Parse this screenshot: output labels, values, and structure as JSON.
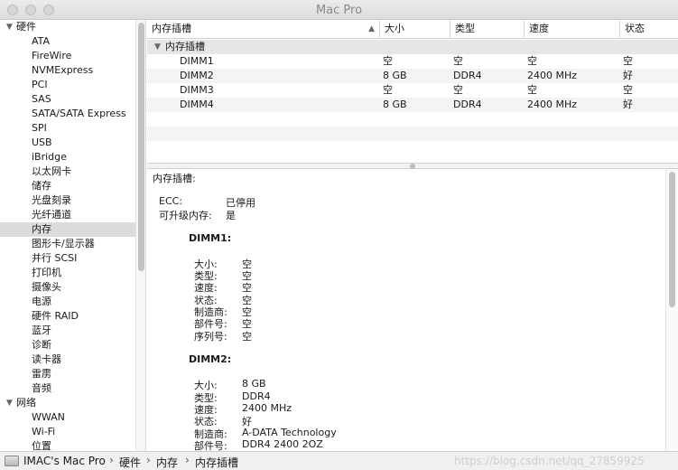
{
  "window": {
    "title": "Mac Pro"
  },
  "sidebar": {
    "groups": [
      {
        "label": "硬件",
        "children": [
          "ATA",
          "FireWire",
          "NVMExpress",
          "PCI",
          "SAS",
          "SATA/SATA Express",
          "SPI",
          "USB",
          "iBridge",
          "以太网卡",
          "储存",
          "光盘刻录",
          "光纤通道",
          "内存",
          "图形卡/显示器",
          "并行 SCSI",
          "打印机",
          "摄像头",
          "电源",
          "硬件 RAID",
          "蓝牙",
          "诊断",
          "读卡器",
          "雷雳",
          "音频"
        ]
      },
      {
        "label": "网络",
        "children": [
          "WWAN",
          "Wi-Fi",
          "位置"
        ]
      }
    ],
    "selected": "内存"
  },
  "table": {
    "columns": [
      "内存插槽",
      "大小",
      "类型",
      "速度",
      "状态"
    ],
    "group_label": "内存插槽",
    "rows": [
      [
        "DIMM1",
        "空",
        "空",
        "空",
        "空"
      ],
      [
        "DIMM2",
        "8 GB",
        "DDR4",
        "2400 MHz",
        "好"
      ],
      [
        "DIMM3",
        "空",
        "空",
        "空",
        "空"
      ],
      [
        "DIMM4",
        "8 GB",
        "DDR4",
        "2400 MHz",
        "好"
      ]
    ]
  },
  "detail": {
    "heading": "内存插槽:",
    "ecc_label": "ECC:",
    "ecc_value": "已停用",
    "upgradable_label": "可升级内存:",
    "upgradable_value": "是",
    "dimm1": {
      "title": "DIMM1:",
      "fields": [
        [
          "大小:",
          "空"
        ],
        [
          "类型:",
          "空"
        ],
        [
          "速度:",
          "空"
        ],
        [
          "状态:",
          "空"
        ],
        [
          "制造商:",
          "空"
        ],
        [
          "部件号:",
          "空"
        ],
        [
          "序列号:",
          "空"
        ]
      ]
    },
    "dimm2": {
      "title": "DIMM2:",
      "fields": [
        [
          "大小:",
          "8 GB"
        ],
        [
          "类型:",
          "DDR4"
        ],
        [
          "速度:",
          "2400 MHz"
        ],
        [
          "状态:",
          "好"
        ],
        [
          "制造商:",
          "A-DATA Technology"
        ],
        [
          "部件号:",
          "DDR4 2400 2OZ"
        ]
      ]
    }
  },
  "pathbar": {
    "crumbs": [
      "IMAC's Mac Pro",
      "硬件",
      "内存",
      "内存插槽"
    ],
    "separator": "›",
    "watermark": "https://blog.csdn.net/qq_27859925"
  }
}
